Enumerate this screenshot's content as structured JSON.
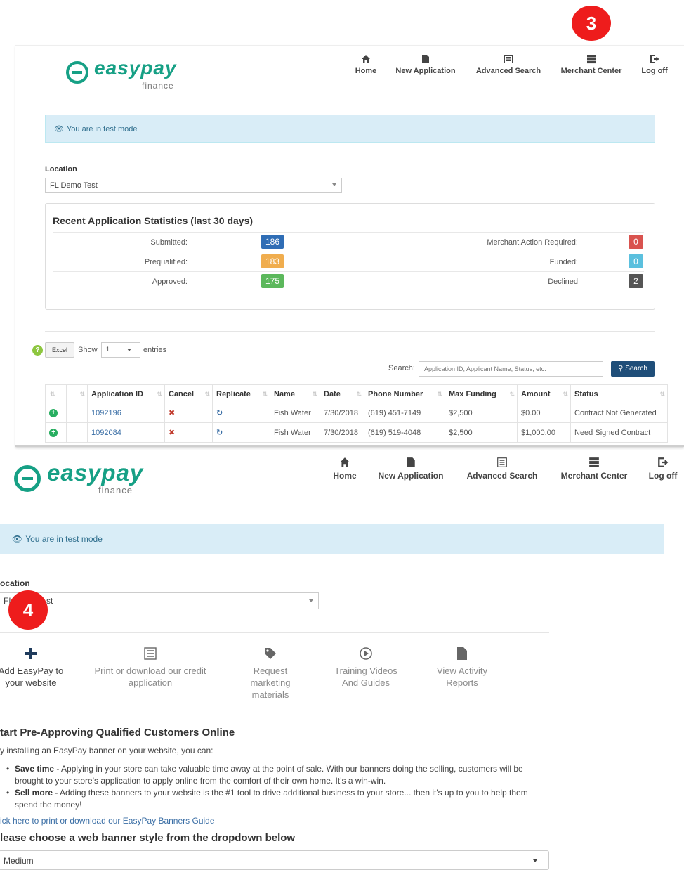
{
  "callouts": [
    "3",
    "4"
  ],
  "screen1": {
    "logo": {
      "word": "easypay",
      "sub": "finance"
    },
    "nav": {
      "home": "Home",
      "new_application": "New Application",
      "advanced_search": "Advanced Search",
      "merchant_center": "Merchant Center",
      "log_off": "Log off"
    },
    "alert": "You are in test mode",
    "location_label": "Location",
    "location_value": "FL Demo Test",
    "stats": {
      "title": "Recent Application Statistics (last 30 days)",
      "left": [
        {
          "label": "Submitted:",
          "value": "186",
          "color": "#2f6db5"
        },
        {
          "label": "Prequalified:",
          "value": "183",
          "color": "#f0ad4e"
        },
        {
          "label": "Approved:",
          "value": "175",
          "color": "#5cb85c"
        }
      ],
      "right": [
        {
          "label": "Merchant Action Required:",
          "value": "0",
          "color": "#d9534f"
        },
        {
          "label": "Funded:",
          "value": "0",
          "color": "#5bc0de"
        },
        {
          "label": "Declined",
          "value": "2",
          "color": "#555555"
        }
      ]
    },
    "controls": {
      "help": "?",
      "excel": "Excel",
      "show": "Show",
      "show_value": "1",
      "entries": "entries",
      "search_label": "Search:",
      "search_placeholder": "Application ID, Applicant Name, Status, etc.",
      "search_button": "Search"
    },
    "table": {
      "headers": [
        "Application ID",
        "Cancel",
        "Replicate",
        "Name",
        "Date",
        "Phone Number",
        "Max Funding",
        "Amount",
        "Status"
      ],
      "rows": [
        {
          "id": "1092196",
          "cancel": "✖",
          "replicate": "↻",
          "name": "Fish Water",
          "date": "7/30/2018",
          "phone": "(619) 451-7149",
          "max": "$2,500",
          "amount": "$0.00",
          "status": "Contract Not Generated"
        },
        {
          "id": "1092084",
          "cancel": "✖",
          "replicate": "↻",
          "name": "Fish Water",
          "date": "7/30/2018",
          "phone": "(619) 519-4048",
          "max": "$2,500",
          "amount": "$1,000.00",
          "status": "Need Signed Contract"
        }
      ]
    }
  },
  "screen2": {
    "logo": {
      "word": "easypay",
      "sub": "finance"
    },
    "nav": {
      "home": "Home",
      "new_application": "New Application",
      "advanced_search": "Advanced Search",
      "merchant_center": "Merchant Center",
      "log_off": "Log off"
    },
    "alert": "You are in test mode",
    "location_label": "ocation",
    "location_value_a": "FL",
    "location_value_b": "st",
    "quick_actions": [
      {
        "line1": "Add EasyPay to",
        "line2": "your website",
        "line3": ""
      },
      {
        "line1": "Print or download our credit",
        "line2": "application",
        "line3": ""
      },
      {
        "line1": "Request",
        "line2": "marketing",
        "line3": "materials"
      },
      {
        "line1": "Training Videos",
        "line2": "And Guides",
        "line3": ""
      },
      {
        "line1": "View Activity",
        "line2": "Reports",
        "line3": ""
      }
    ],
    "heading1": "tart Pre-Approving Qualified Customers Online",
    "intro": "y installing an EasyPay banner on your website, you can:",
    "bullets": [
      {
        "bold": "Save time",
        "text": " - Applying in your store can take valuable time away at the point of sale. With our banners doing the selling, customers will be brought to your store's application to apply online from the comfort of their own home. It's a win-win."
      },
      {
        "bold": "Sell more",
        "text": " - Adding these banners to your website is the #1 tool to drive additional business to your store... then it's up to you to help them spend the money!"
      }
    ],
    "guide_link": "ick here to print or download our EasyPay Banners Guide",
    "heading2": "lease choose a web banner style from the dropdown below",
    "banner_select": "Medium"
  }
}
